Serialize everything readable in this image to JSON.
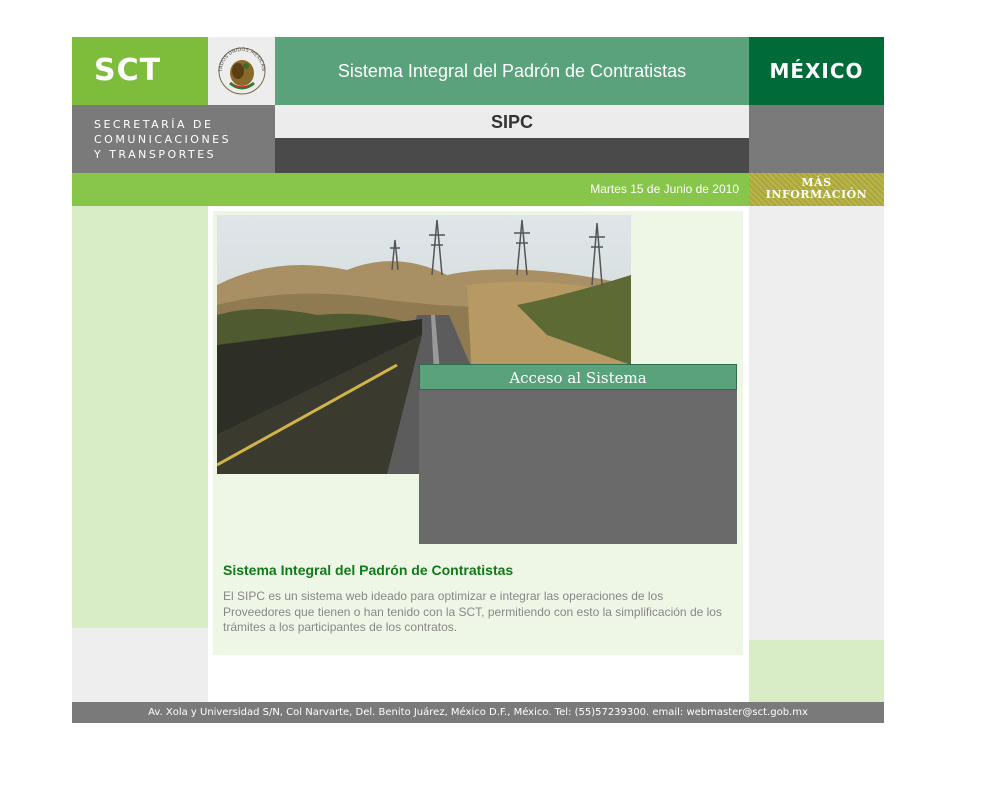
{
  "header": {
    "logo": "SCT",
    "title": "Sistema Integral del Padrón de Contratistas",
    "country": "MÉXICO",
    "secretaria_lines": [
      "SECRETARÍA DE",
      "COMUNICACIONES",
      "Y TRANSPORTES"
    ],
    "subtitle": "SIPC",
    "seal_text": "ESTADOS UNIDOS MEXICANOS"
  },
  "date_bar": {
    "date": "Martes 15 de Junio de 2010",
    "more_info_line1": "MÁS",
    "more_info_line2": "INFORMACIÓN"
  },
  "main": {
    "access_label": "Acceso al Sistema",
    "info_title": "Sistema Integral del Padrón de Contratistas",
    "info_text": "El SIPC es un sistema web ideado para optimizar e integrar las operaciones de los Proveedores que tienen o han tenido con la SCT, permitiendo con esto la simplificación de los trámites a los participantes de los contratos."
  },
  "footer": {
    "text": "Av. Xola y Universidad S/N, Col Narvarte, Del. Benito Juárez, México D.F., México. Tel: (55)57239300. email: webmaster@sct.gob.mx"
  },
  "colors": {
    "brand_green": "#7dbd3b",
    "title_green": "#5aa27c",
    "mexico_green": "#006b38",
    "gray": "#7a7a7a",
    "info_title_green": "#0f7a18"
  }
}
